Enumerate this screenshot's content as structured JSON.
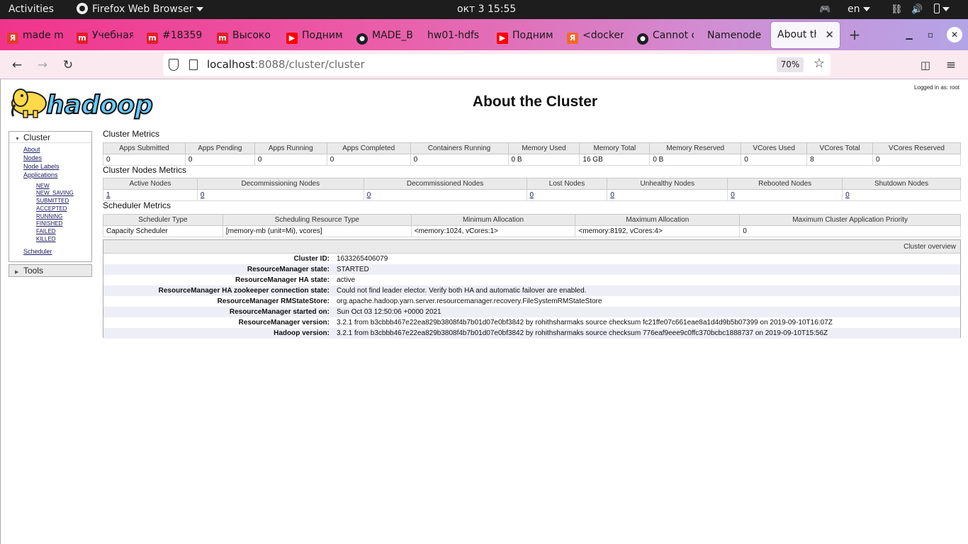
{
  "topbar": {
    "activities": "Activities",
    "app_name": "Firefox Web Browser",
    "clock": "окт 3  15:55",
    "lang": "en"
  },
  "tabs": [
    {
      "title": "made m",
      "icon": "yandex-icon",
      "color": "#e73a2c",
      "glyph": "Я"
    },
    {
      "title": "Учебная",
      "icon": "mail-m-icon",
      "color": "#e0202a",
      "glyph": "m"
    },
    {
      "title": "#18359",
      "icon": "mail-m-icon",
      "color": "#e0202a",
      "glyph": "m"
    },
    {
      "title": "Высоко",
      "icon": "mail-m-icon",
      "color": "#e0202a",
      "glyph": "m"
    },
    {
      "title": "Подним",
      "icon": "youtube-icon",
      "color": "#ff0000",
      "glyph": "▶"
    },
    {
      "title": "MADE_B",
      "icon": "github-icon",
      "color": "#1b1f23",
      "glyph": "●"
    },
    {
      "title": "hw01-hdfs",
      "icon": "",
      "color": "",
      "glyph": ""
    },
    {
      "title": "Подним",
      "icon": "youtube-icon",
      "color": "#ff0000",
      "glyph": "▶"
    },
    {
      "title": "<docker",
      "icon": "yandex-icon",
      "color": "#f06a2c",
      "glyph": "Я"
    },
    {
      "title": "Cannot c",
      "icon": "github-icon",
      "color": "#1b1f23",
      "glyph": "●"
    },
    {
      "title": "Namenode",
      "icon": "",
      "color": "",
      "glyph": ""
    }
  ],
  "active_tab": {
    "title": "About the"
  },
  "navbar": {
    "url_host": "localhost",
    "url_path": ":8088/cluster/cluster",
    "zoom": "70%"
  },
  "page": {
    "logged_in": "Logged in as: root",
    "title": "About the Cluster",
    "logo_text": "hadoop"
  },
  "sidebar": {
    "cluster_label": "Cluster",
    "links": [
      "About",
      "Nodes",
      "Node Labels",
      "Applications"
    ],
    "app_states": [
      "NEW",
      "NEW_SAVING",
      "SUBMITTED",
      "ACCEPTED",
      "RUNNING",
      "FINISHED",
      "FAILED",
      "KILLED"
    ],
    "scheduler": "Scheduler",
    "tools_label": "Tools"
  },
  "cluster_metrics": {
    "title": "Cluster Metrics",
    "headers": [
      "Apps Submitted",
      "Apps Pending",
      "Apps Running",
      "Apps Completed",
      "Containers Running",
      "Memory Used",
      "Memory Total",
      "Memory Reserved",
      "VCores Used",
      "VCores Total",
      "VCores Reserved"
    ],
    "values": [
      "0",
      "0",
      "0",
      "0",
      "0",
      "0 B",
      "16 GB",
      "0 B",
      "0",
      "8",
      "0"
    ]
  },
  "nodes_metrics": {
    "title": "Cluster Nodes Metrics",
    "headers": [
      "Active Nodes",
      "Decommissioning Nodes",
      "Decommissioned Nodes",
      "Lost Nodes",
      "Unhealthy Nodes",
      "Rebooted Nodes",
      "Shutdown Nodes"
    ],
    "values": [
      "1",
      "0",
      "0",
      "0",
      "0",
      "0",
      "0"
    ]
  },
  "scheduler_metrics": {
    "title": "Scheduler Metrics",
    "headers": [
      "Scheduler Type",
      "Scheduling Resource Type",
      "Minimum Allocation",
      "Maximum Allocation",
      "Maximum Cluster Application Priority"
    ],
    "values": [
      "Capacity Scheduler",
      "[memory-mb (unit=Mi), vcores]",
      "<memory:1024, vCores:1>",
      "<memory:8192, vCores:4>",
      "0"
    ]
  },
  "overview": {
    "title": "Cluster overview",
    "rows": [
      {
        "key": "Cluster ID:",
        "value": "1633265406079"
      },
      {
        "key": "ResourceManager state:",
        "value": "STARTED"
      },
      {
        "key": "ResourceManager HA state:",
        "value": "active"
      },
      {
        "key": "ResourceManager HA zookeeper connection state:",
        "value": "Could not find leader elector. Verify both HA and automatic failover are enabled."
      },
      {
        "key": "ResourceManager RMStateStore:",
        "value": "org.apache.hadoop.yarn.server.resourcemanager.recovery.FileSystemRMStateStore"
      },
      {
        "key": "ResourceManager started on:",
        "value": "Sun Oct 03 12:50:06 +0000 2021"
      },
      {
        "key": "ResourceManager version:",
        "value": "3.2.1 from b3cbbb467e22ea829b3808f4b7b01d07e0bf3842 by rohithsharmaks source checksum fc21ffe07c661eae8a1d4d9b5b07399 on 2019-09-10T16:07Z"
      },
      {
        "key": "Hadoop version:",
        "value": "3.2.1 from b3cbbb467e22ea829b3808f4b7b01d07e0bf3842 by rohithsharmaks source checksum 776eaf9eee9c0ffc370bcbc1888737 on 2019-09-10T15:56Z"
      }
    ]
  }
}
